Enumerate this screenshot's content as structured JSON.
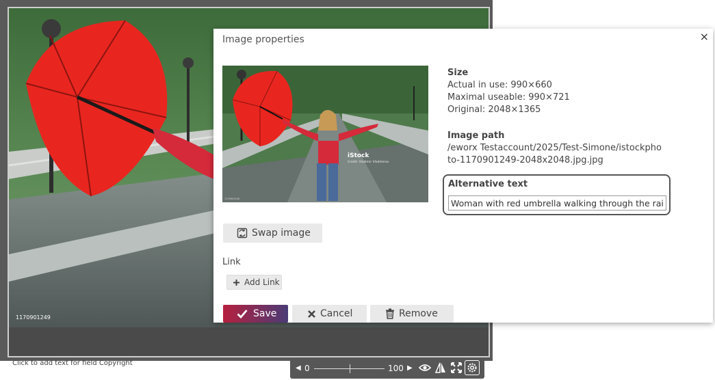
{
  "editor": {
    "photo_id": "1170901249",
    "copyright_hint": "Click to add text for field Copyright",
    "toolbar": {
      "min_value": "0",
      "max_value": "100",
      "zoom_position": 0.5
    }
  },
  "dialog": {
    "title": "Image properties",
    "close_glyph": "×",
    "size": {
      "heading": "Size",
      "actual": "Actual in use: 990×660",
      "maximal": "Maximal useable: 990×721",
      "original": "Original: 2048×1365"
    },
    "path": {
      "heading": "Image path",
      "line1": "/eworx Testaccount/2025/Test-Simone/istockpho",
      "line2": "to-1170901249-2048x2048.jpg.jpg"
    },
    "alt": {
      "label": "Alternative text",
      "value": "Woman with red umbrella walking through the rain"
    },
    "swap_label": "Swap image",
    "link_label": "Link",
    "add_link_label": "Add Link",
    "save_label": "Save",
    "cancel_label": "Cancel",
    "remove_label": "Remove",
    "preview": {
      "brand": "iStock",
      "credit": "Credit: Vladimir Vladimirov",
      "id": "1170901249"
    }
  },
  "colors": {
    "save_gradient_start": "#b6203f",
    "save_gradient_end": "#4a3b76",
    "umbrella": "#e8261f",
    "jacket": "#d42a3a"
  },
  "icons": [
    "swap-image-icon",
    "plus-icon",
    "check-icon",
    "x-icon",
    "trash-icon",
    "eye-icon",
    "flip-icon",
    "fullscreen-icon",
    "gear-icon"
  ]
}
